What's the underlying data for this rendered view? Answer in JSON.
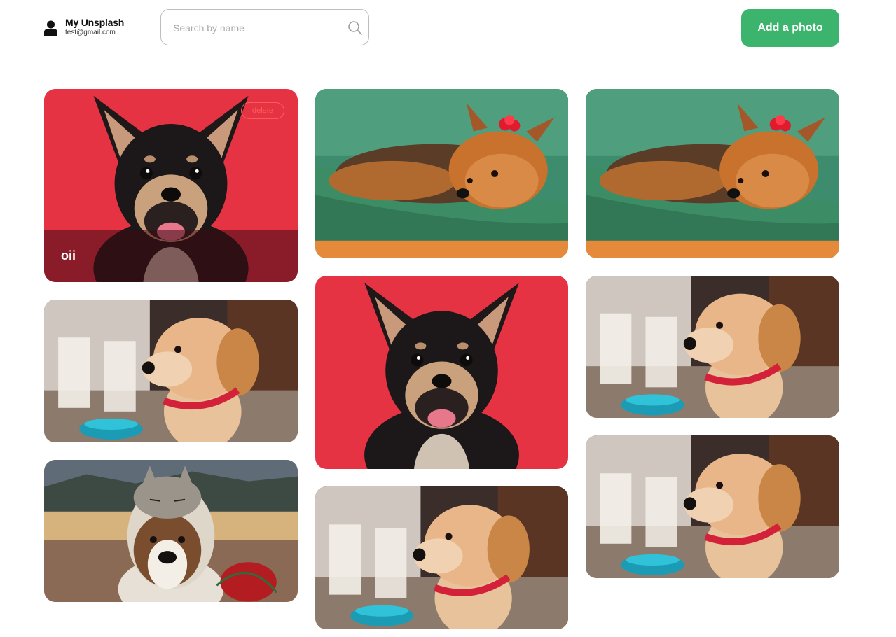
{
  "header": {
    "app_name": "My Unsplash",
    "user_email": "test@gmail.com",
    "search_placeholder": "Search by name",
    "search_value": "",
    "add_button_label": "Add a photo"
  },
  "colors": {
    "accent": "#3db46d",
    "delete": "#ff5a5a"
  },
  "photos": [
    {
      "kind": "chihuahua",
      "label": "oii",
      "delete_label": "delete",
      "hovered": true
    },
    {
      "kind": "puppy"
    },
    {
      "kind": "cat-dog"
    },
    {
      "kind": "yorkie"
    },
    {
      "kind": "chihuahua"
    },
    {
      "kind": "puppy"
    },
    {
      "kind": "yorkie"
    },
    {
      "kind": "puppy"
    },
    {
      "kind": "puppy"
    }
  ]
}
